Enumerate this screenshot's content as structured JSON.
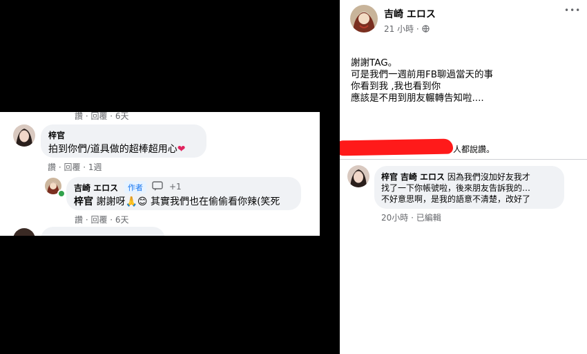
{
  "left": {
    "top_actions": "讚 · 回覆 · 6天",
    "comment1": {
      "author": "梓官",
      "text": "拍到你們/道具做的超棒超用心",
      "heart": "❤",
      "actions": "讚 · 回覆 · 1週"
    },
    "reply1": {
      "author": "吉崎 エロス",
      "badge": "作者",
      "plus_count": "+1",
      "mention": "梓官",
      "text_before": "謝謝呀",
      "emoji_pray": "🙏",
      "emoji_smile": "😊",
      "text_after": "其實我們也在偷偷看你辣(笑死",
      "actions": "讚 · 回覆 · 6天"
    }
  },
  "right": {
    "post": {
      "author": "吉崎 エロス",
      "time": "21 小時 ·",
      "more": "•••",
      "lines": [
        "謝謝TAG。",
        "可是我們一週前用FB聊過當天的事",
        "你看到我 ,我也看到你",
        "應該是不用到朋友輾轉告知啦...."
      ],
      "reactions_suffix": "人都說讚。"
    },
    "comment": {
      "mention": "梓官",
      "author": "吉崎 エロス",
      "line1": "因為我們沒加好友我才",
      "line2": "找了一下你帳號啦，後來朋友告訴我的…",
      "line3": "不好意思啊，是我的語意不清楚，改好了",
      "time": "20小時",
      "edited": "已編輯"
    }
  },
  "colors": {
    "bubble": "#f0f2f5",
    "meta": "#65676b",
    "link": "#385898",
    "redaction": "#ff1a1a",
    "online": "#31a24c",
    "heart": "#e0245e"
  }
}
